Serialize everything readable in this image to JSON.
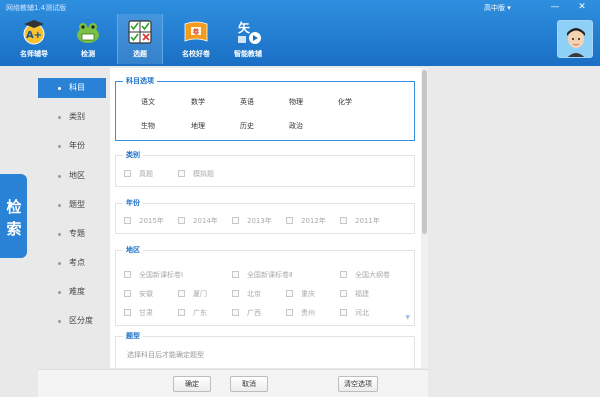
{
  "window": {
    "title": "网络教辅1.4测试版",
    "level_select": "高中版 ▾",
    "minimize": "—",
    "close": "✕"
  },
  "toolbar": {
    "items": [
      {
        "label": "名师辅导",
        "icon": "a-plus-mortarboard-icon"
      },
      {
        "label": "检测",
        "icon": "frog-test-icon"
      },
      {
        "label": "选题",
        "icon": "checklist-icon"
      },
      {
        "label": "名校好卷",
        "icon": "exam-paper-icon"
      },
      {
        "label": "智能教辅",
        "icon": "smart-tutor-icon"
      }
    ],
    "accent": "#1a6fc4"
  },
  "side_tab": {
    "label": "检索"
  },
  "nav": {
    "items": [
      "科目",
      "类别",
      "年份",
      "地区",
      "题型",
      "专题",
      "考点",
      "难度",
      "区分度"
    ],
    "active_index": 0
  },
  "sections": {
    "subject": {
      "title": "科目选项",
      "items": [
        "语文",
        "数学",
        "英语",
        "物理",
        "化学",
        "生物",
        "地理",
        "历史",
        "政治"
      ]
    },
    "category": {
      "title": "类别",
      "options": [
        "真题",
        "模拟题"
      ]
    },
    "year": {
      "title": "年份",
      "options": [
        "2015年",
        "2014年",
        "2013年",
        "2012年",
        "2011年"
      ]
    },
    "region": {
      "title": "地区",
      "options": [
        "全国新课标卷Ⅰ",
        "全国新课标卷Ⅱ",
        "全国大纲卷",
        "安徽",
        "厦门",
        "北京",
        "重庆",
        "福建",
        "甘肃",
        "广东",
        "广西",
        "贵州",
        "河北"
      ]
    },
    "question_type": {
      "title": "题型",
      "hint": "选择科目后才能确定题型"
    }
  },
  "footer": {
    "confirm": "确定",
    "cancel": "取消",
    "clear": "清空选项"
  }
}
